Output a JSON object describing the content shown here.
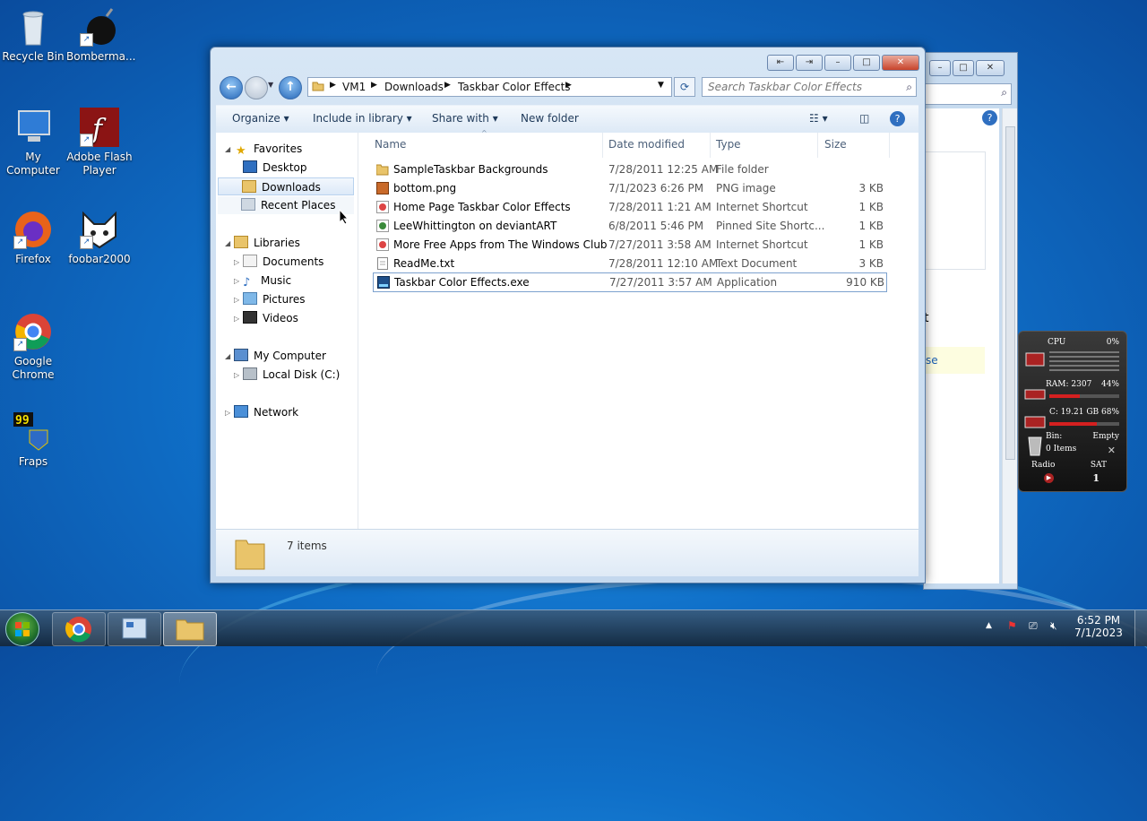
{
  "desktop": {
    "icons": [
      {
        "label": "Recycle Bin"
      },
      {
        "label": "Bomberma..."
      },
      {
        "label": "My Computer"
      },
      {
        "label": "Adobe Flash Player"
      },
      {
        "label": "Firefox"
      },
      {
        "label": "foobar2000"
      },
      {
        "label": "Google Chrome"
      },
      {
        "label": "Fraps"
      }
    ]
  },
  "window": {
    "breadcrumb": [
      "VM1",
      "Downloads",
      "Taskbar Color Effects"
    ],
    "search_placeholder": "Search Taskbar Color Effects",
    "toolbar": {
      "organize": "Organize",
      "include": "Include in library",
      "share": "Share with",
      "new_folder": "New folder"
    },
    "nav": {
      "favorites": "Favorites",
      "desktop": "Desktop",
      "downloads": "Downloads",
      "recent": "Recent Places",
      "libraries": "Libraries",
      "documents": "Documents",
      "music": "Music",
      "pictures": "Pictures",
      "videos": "Videos",
      "computer": "My Computer",
      "localdisk": "Local Disk (C:)",
      "network": "Network"
    },
    "columns": {
      "name": "Name",
      "date": "Date modified",
      "type": "Type",
      "size": "Size"
    },
    "files": [
      {
        "name": "SampleTaskbar Backgrounds",
        "date": "7/28/2011 12:25 AM",
        "type": "File folder",
        "size": "",
        "icon": "folder-icon"
      },
      {
        "name": "bottom.png",
        "date": "7/1/2023 6:26 PM",
        "type": "PNG image",
        "size": "3 KB",
        "icon": "png-icon"
      },
      {
        "name": "Home Page Taskbar Color Effects",
        "date": "7/28/2011 1:21 AM",
        "type": "Internet Shortcut",
        "size": "1 KB",
        "icon": "url-icon"
      },
      {
        "name": "LeeWhittington on deviantART",
        "date": "6/8/2011 5:46 PM",
        "type": "Pinned Site Shortc...",
        "size": "1 KB",
        "icon": "pinned-site-icon"
      },
      {
        "name": "More Free Apps from The Windows Club",
        "date": "7/27/2011 3:58 AM",
        "type": "Internet Shortcut",
        "size": "1 KB",
        "icon": "url-icon"
      },
      {
        "name": "ReadMe.txt",
        "date": "7/28/2011 12:10 AM",
        "type": "Text Document",
        "size": "3 KB",
        "icon": "txt-icon"
      },
      {
        "name": "Taskbar Color Effects.exe",
        "date": "7/27/2011 3:57 AM",
        "type": "Application",
        "size": "910 KB",
        "icon": "exe-icon"
      }
    ],
    "status": "7 items"
  },
  "backwindow": {
    "partial_text_1": "t",
    "partial_text_2": "se"
  },
  "gadget": {
    "cpu_label": "CPU",
    "cpu_value": "0%",
    "ram_label": "RAM: 2307",
    "ram_value": "44%",
    "disk_label": "C:",
    "disk_value": "19.21 GB 68%",
    "bin_label": "Bin:",
    "bin_value": "Empty",
    "bin_items": "0 Items",
    "radio_label": "Radio",
    "day": "SAT",
    "date": "1",
    "ram_fraction": 0.44,
    "disk_fraction": 0.68
  },
  "taskbar": {
    "time": "6:52 PM",
    "date": "7/1/2023"
  }
}
